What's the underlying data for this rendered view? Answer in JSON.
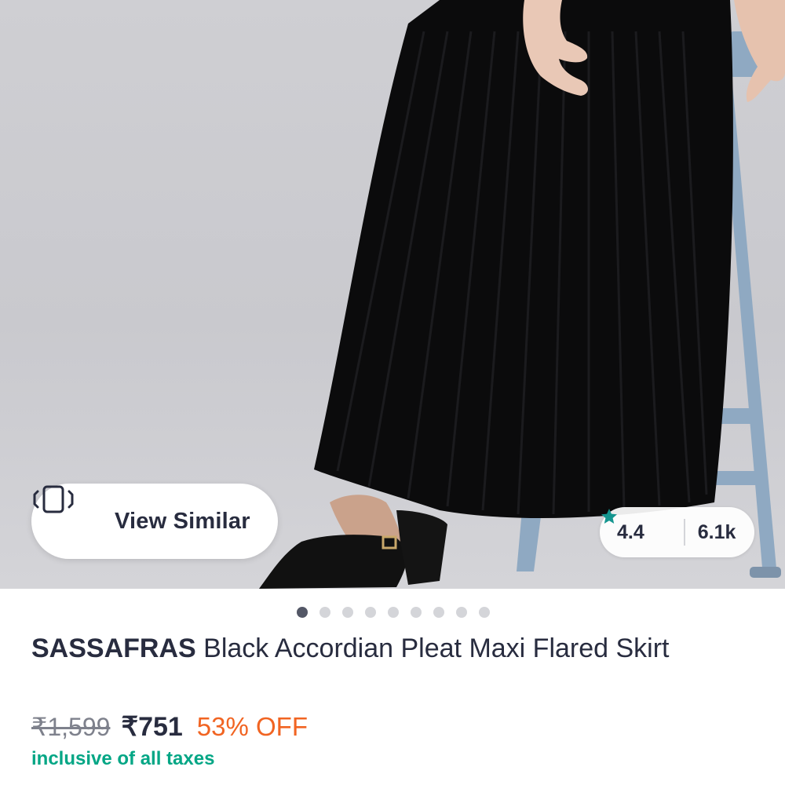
{
  "product_image": {
    "view_similar": {
      "label": "View Similar",
      "icon": "view-similar-icon"
    },
    "rating": {
      "score": "4.4",
      "icon": "star-icon",
      "count": "6.1k",
      "star_color": "#14958f"
    },
    "carousel": {
      "total": 9,
      "active_index": 0
    }
  },
  "product": {
    "brand": "SASSAFRAS",
    "name": " Black Accordian Pleat Maxi Flared Skirt",
    "mrp": "₹1,599",
    "price": "₹751",
    "discount": "53% OFF",
    "tax_note": "inclusive of all taxes"
  },
  "colors": {
    "discount": "#f16422",
    "tax_note": "#03a685",
    "text_primary": "#282c3f"
  }
}
